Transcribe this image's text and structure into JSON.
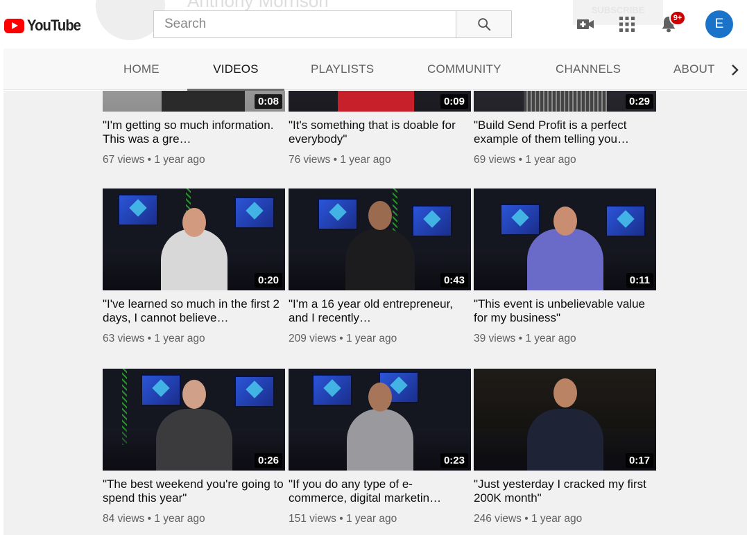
{
  "masthead": {
    "logo_text": "YouTube",
    "search_placeholder": "Search",
    "channel_name_ghost": "Anthony Morrison",
    "subscribe_ghost": "SUBSCRIBE",
    "notification_badge": "9+",
    "avatar_letter": "E"
  },
  "tabs": [
    "HOME",
    "VIDEOS",
    "PLAYLISTS",
    "COMMUNITY",
    "CHANNELS",
    "ABOUT"
  ],
  "active_tab": "VIDEOS",
  "videos": [
    {
      "duration": "0:08",
      "title": "\"I'm getting so much information. This was a gre…",
      "views": "67 views",
      "age": "1 year ago"
    },
    {
      "duration": "0:09",
      "title": "\"It's something that is doable for everybody\"",
      "views": "76 views",
      "age": "1 year ago"
    },
    {
      "duration": "0:29",
      "title": "\"Build Send Profit is a perfect example of them telling you…",
      "views": "69 views",
      "age": "1 year ago"
    },
    {
      "duration": "0:20",
      "title": "\"I've learned so much in the first 2 days, I cannot believe…",
      "views": "63 views",
      "age": "1 year ago"
    },
    {
      "duration": "0:43",
      "title": "\"I'm a 16 year old entrepreneur, and I recently…",
      "views": "209 views",
      "age": "1 year ago"
    },
    {
      "duration": "0:11",
      "title": "\"This event is unbelievable value for my business\"",
      "views": "39 views",
      "age": "1 year ago"
    },
    {
      "duration": "0:26",
      "title": "\"The best weekend you're going to spend this year\"",
      "views": "84 views",
      "age": "1 year ago"
    },
    {
      "duration": "0:23",
      "title": "\"If you do any type of e-commerce, digital marketin…",
      "views": "151 views",
      "age": "1 year ago"
    },
    {
      "duration": "0:17",
      "title": "\"Just yesterday I cracked my first 200K month\"",
      "views": "246 views",
      "age": "1 year ago"
    }
  ],
  "colors": {
    "brand_red": "#ff0000",
    "avatar_blue": "#1a73c9",
    "badge_red": "#cc0000",
    "content_bg": "#f1f1f1",
    "tabbar_bg": "#f8f8f8"
  },
  "icons": [
    "search-icon",
    "create-video-icon",
    "apps-grid-icon",
    "bell-icon",
    "chevron-right-icon"
  ]
}
